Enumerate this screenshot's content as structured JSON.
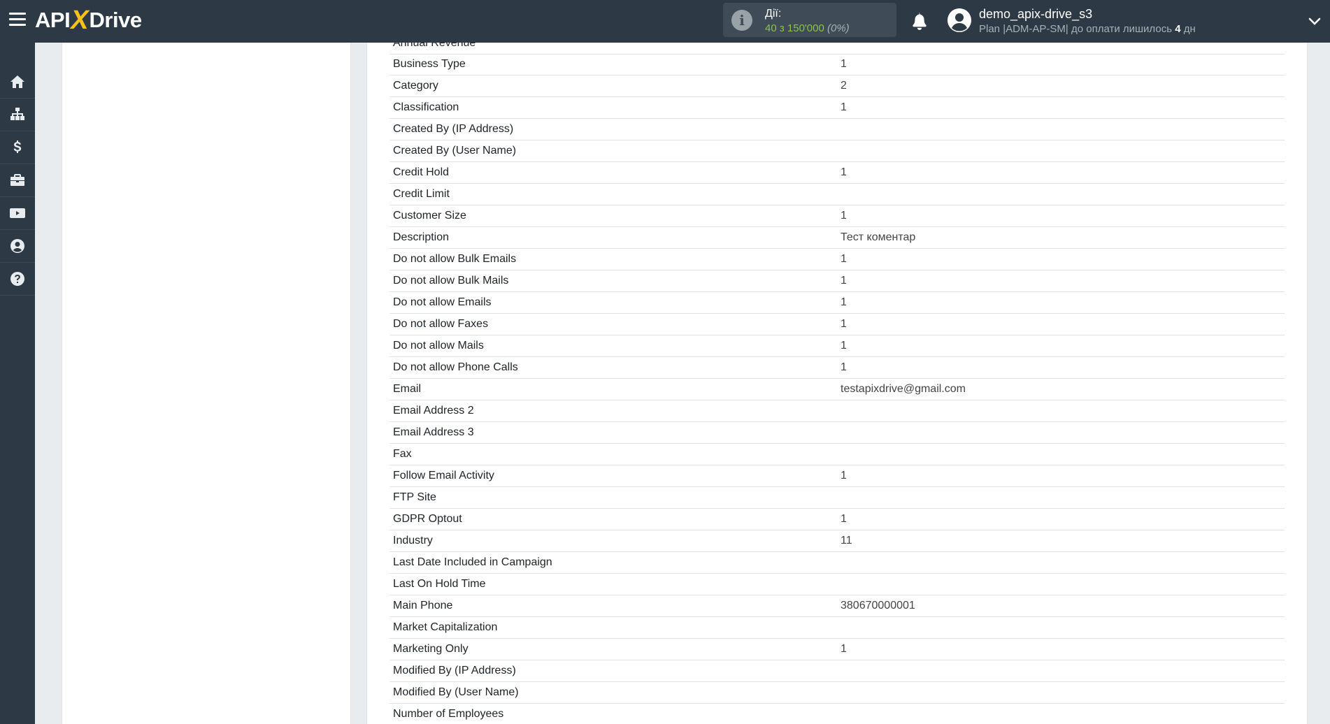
{
  "header": {
    "logo": {
      "part1": "API",
      "part2": "X",
      "part3": "Drive"
    },
    "actions": {
      "label": "Дії:",
      "count": "40 з 150'000",
      "percent": "(0%)"
    },
    "user": {
      "name": "demo_apix-drive_s3",
      "plan_prefix": "Plan |ADM-AP-SM| до оплати лишилось ",
      "days": "4",
      "days_unit": " дн"
    }
  },
  "sidebar": {
    "items": [
      {
        "icon": "home-icon"
      },
      {
        "icon": "sitemap-icon"
      },
      {
        "icon": "dollar-icon"
      },
      {
        "icon": "briefcase-icon"
      },
      {
        "icon": "youtube-icon"
      },
      {
        "icon": "user-circle-icon"
      },
      {
        "icon": "help-icon"
      }
    ]
  },
  "fields": {
    "partial_label": "Annual Revenue",
    "rows": [
      {
        "label": "Business Type",
        "value": "1"
      },
      {
        "label": "Category",
        "value": "2"
      },
      {
        "label": "Classification",
        "value": "1"
      },
      {
        "label": "Created By (IP Address)",
        "value": ""
      },
      {
        "label": "Created By (User Name)",
        "value": ""
      },
      {
        "label": "Credit Hold",
        "value": "1"
      },
      {
        "label": "Credit Limit",
        "value": ""
      },
      {
        "label": "Customer Size",
        "value": "1"
      },
      {
        "label": "Description",
        "value": "Тест коментар"
      },
      {
        "label": "Do not allow Bulk Emails",
        "value": "1"
      },
      {
        "label": "Do not allow Bulk Mails",
        "value": "1"
      },
      {
        "label": "Do not allow Emails",
        "value": "1"
      },
      {
        "label": "Do not allow Faxes",
        "value": "1"
      },
      {
        "label": "Do not allow Mails",
        "value": "1"
      },
      {
        "label": "Do not allow Phone Calls",
        "value": "1"
      },
      {
        "label": "Email",
        "value": "testapixdrive@gmail.com"
      },
      {
        "label": "Email Address 2",
        "value": ""
      },
      {
        "label": "Email Address 3",
        "value": ""
      },
      {
        "label": "Fax",
        "value": ""
      },
      {
        "label": "Follow Email Activity",
        "value": "1"
      },
      {
        "label": "FTP Site",
        "value": ""
      },
      {
        "label": "GDPR Optout",
        "value": "1"
      },
      {
        "label": "Industry",
        "value": "11"
      },
      {
        "label": "Last Date Included in Campaign",
        "value": ""
      },
      {
        "label": "Last On Hold Time",
        "value": ""
      },
      {
        "label": "Main Phone",
        "value": "380670000001"
      },
      {
        "label": "Market Capitalization",
        "value": ""
      },
      {
        "label": "Marketing Only",
        "value": "1"
      },
      {
        "label": "Modified By (IP Address)",
        "value": ""
      },
      {
        "label": "Modified By (User Name)",
        "value": ""
      },
      {
        "label": "Number of Employees",
        "value": ""
      }
    ]
  }
}
